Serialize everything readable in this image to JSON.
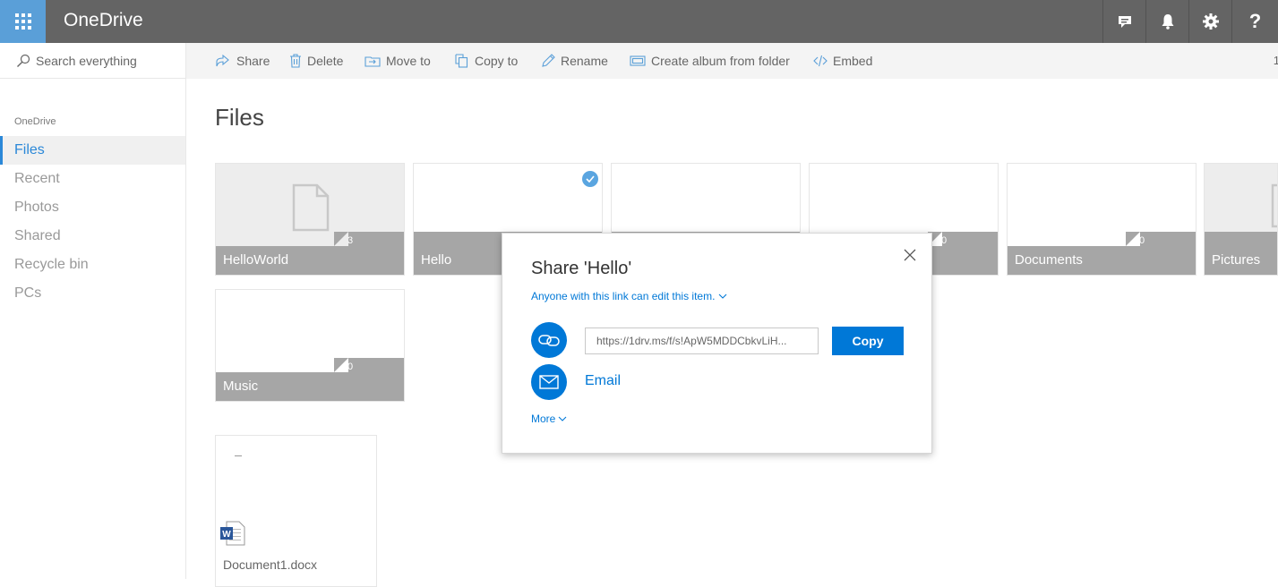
{
  "app": {
    "title": "OneDrive"
  },
  "topbar": {
    "icons": [
      "waffle-icon",
      "chat-icon",
      "bell-icon",
      "gear-icon",
      "help-icon"
    ],
    "help_label": "?"
  },
  "search": {
    "placeholder": "Search everything"
  },
  "nav": {
    "caption": "OneDrive",
    "items": [
      {
        "label": "Files",
        "active": true
      },
      {
        "label": "Recent"
      },
      {
        "label": "Photos"
      },
      {
        "label": "Shared"
      },
      {
        "label": "Recycle bin"
      },
      {
        "label": "PCs"
      }
    ]
  },
  "commands": [
    {
      "label": "Share",
      "icon": "share-icon"
    },
    {
      "label": "Delete",
      "icon": "trash-icon"
    },
    {
      "label": "Move to",
      "icon": "move-icon"
    },
    {
      "label": "Copy to",
      "icon": "copy-icon"
    },
    {
      "label": "Rename",
      "icon": "pencil-icon"
    },
    {
      "label": "Create album from folder",
      "icon": "album-icon"
    },
    {
      "label": "Embed",
      "icon": "code-icon"
    }
  ],
  "command_overflow": "1",
  "main": {
    "heading": "Files"
  },
  "folders": [
    {
      "name": "HelloWorld",
      "count": "3"
    },
    {
      "name": "Hello",
      "count": "",
      "selected": true
    },
    {
      "name": "",
      "count": ""
    },
    {
      "name": "",
      "count": "0"
    },
    {
      "name": "Documents",
      "count": "0"
    },
    {
      "name": "Pictures",
      "count": ""
    },
    {
      "name": "Music",
      "count": "0"
    }
  ],
  "files": [
    {
      "name": "Document1.docx"
    }
  ],
  "share_dialog": {
    "title": "Share 'Hello'",
    "permission": "Anyone with this link can edit this item.",
    "link_value": "https://1drv.ms/f/s!ApW5MDDCbkvLiH...",
    "copy_label": "Copy",
    "email_label": "Email",
    "more_label": "More"
  },
  "colors": {
    "topbar": "#646464",
    "waffle": "#5a9fd8",
    "accent": "#0078d7",
    "tile_strip": "#a6a6a6"
  }
}
